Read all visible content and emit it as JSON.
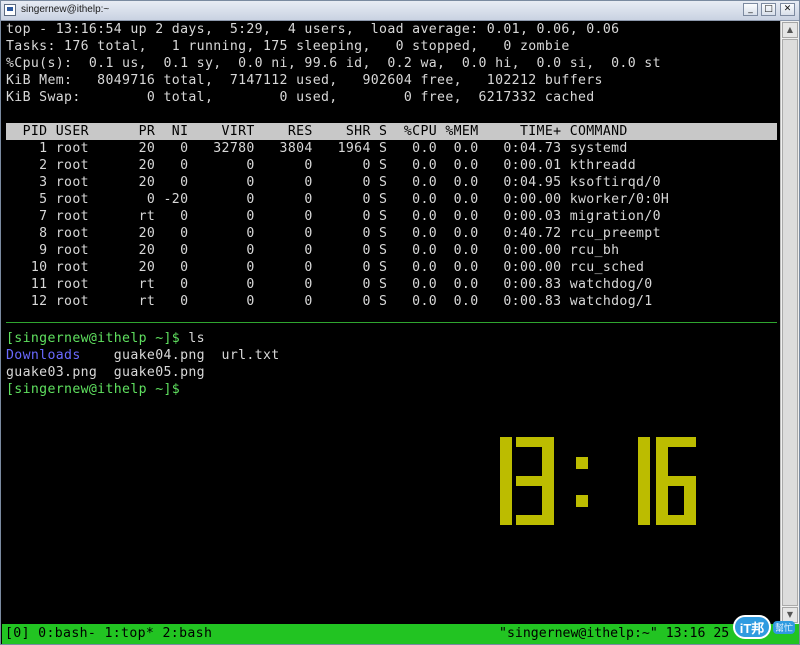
{
  "window": {
    "title": "singernew@ithelp:~"
  },
  "top": {
    "summary": [
      "top - 13:16:54 up 2 days,  5:29,  4 users,  load average: 0.01, 0.06, 0.06",
      "Tasks: 176 total,   1 running, 175 sleeping,   0 stopped,   0 zombie",
      "%Cpu(s):  0.1 us,  0.1 sy,  0.0 ni, 99.6 id,  0.2 wa,  0.0 hi,  0.0 si,  0.0 st",
      "KiB Mem:   8049716 total,  7147112 used,   902604 free,   102212 buffers",
      "KiB Swap:        0 total,        0 used,        0 free,  6217332 cached"
    ],
    "header": "  PID USER      PR  NI    VIRT    RES    SHR S  %CPU %MEM     TIME+ COMMAND",
    "processes": [
      "    1 root      20   0   32780   3804   1964 S   0.0  0.0   0:04.73 systemd",
      "    2 root      20   0       0      0      0 S   0.0  0.0   0:00.01 kthreadd",
      "    3 root      20   0       0      0      0 S   0.0  0.0   0:04.95 ksoftirqd/0",
      "    5 root       0 -20       0      0      0 S   0.0  0.0   0:00.00 kworker/0:0H",
      "    7 root      rt   0       0      0      0 S   0.0  0.0   0:00.03 migration/0",
      "    8 root      20   0       0      0      0 S   0.0  0.0   0:40.72 rcu_preempt",
      "    9 root      20   0       0      0      0 S   0.0  0.0   0:00.00 rcu_bh",
      "   10 root      20   0       0      0      0 S   0.0  0.0   0:00.00 rcu_sched",
      "   11 root      rt   0       0      0      0 S   0.0  0.0   0:00.83 watchdog/0",
      "   12 root      rt   0       0      0      0 S   0.0  0.0   0:00.83 watchdog/1"
    ]
  },
  "shell": {
    "prompt1": "[singernew@ithelp ~]$",
    "command1": " ls",
    "dir_entry": "Downloads",
    "ls_row1_rest": "    guake04.png  url.txt",
    "ls_row2": "guake03.png  guake05.png",
    "prompt2": "[singernew@ithelp ~]$"
  },
  "clock": {
    "text": "13: 16",
    "color": "#bcbc00"
  },
  "status_bar": {
    "left": "[0] 0:bash- 1:top* 2:bash",
    "right": "\"singernew@ithelp:~\" 13:16 25"
  },
  "badge": {
    "logo_text": "iT邦",
    "sub_text": "幫忙"
  },
  "colors": {
    "prompt": "#5fe05f",
    "directory": "#6a6aff",
    "status_bg": "#22c422",
    "header_bg": "#c8c8c8"
  }
}
